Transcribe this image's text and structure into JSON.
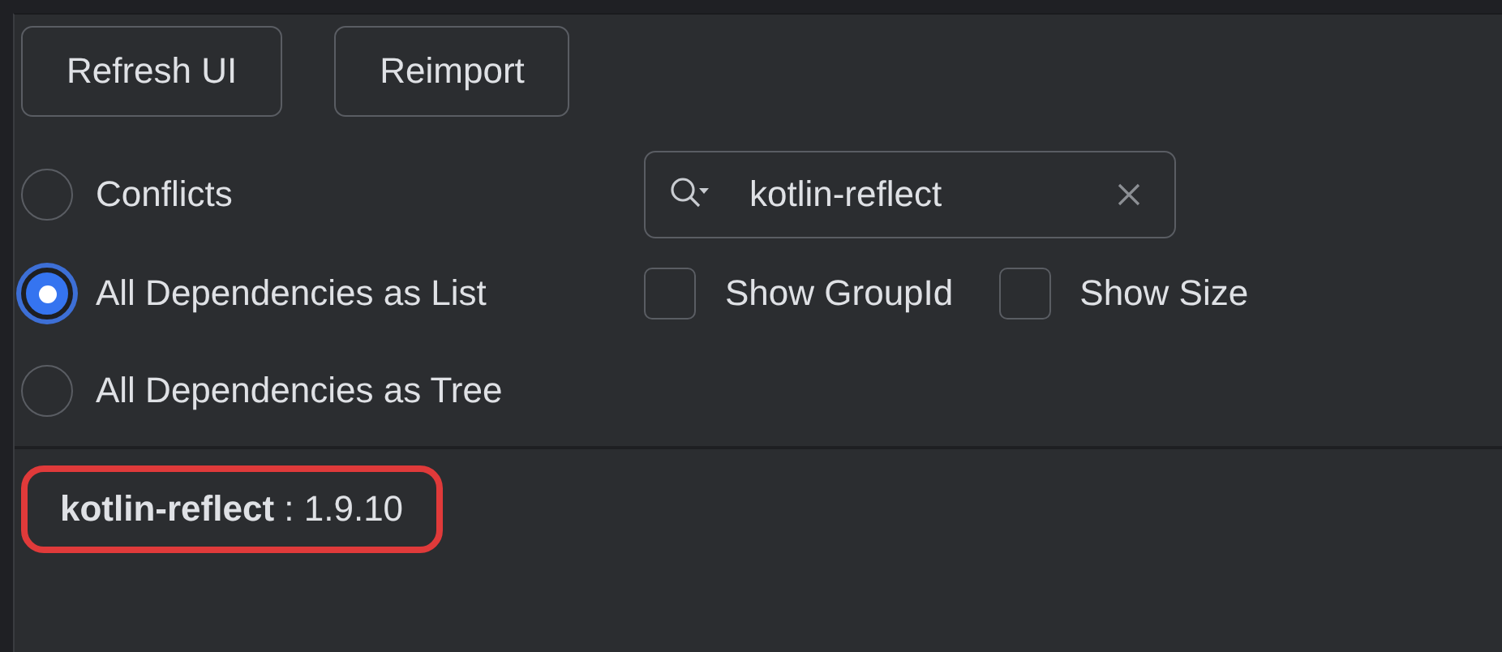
{
  "buttons": [
    "Refresh UI",
    "Reimport"
  ],
  "view_modes": [
    {
      "label": "Conflicts",
      "selected": false
    },
    {
      "label": "All Dependencies as List",
      "selected": true
    },
    {
      "label": "All Dependencies as Tree",
      "selected": false
    }
  ],
  "search": {
    "value": "kotlin-reflect"
  },
  "options": [
    {
      "label": "Show GroupId",
      "checked": false
    },
    {
      "label": "Show Size",
      "checked": false
    }
  ],
  "results": [
    {
      "text": "**kotlin-reflect** : 1.9.10",
      "highlighted": true
    }
  ]
}
